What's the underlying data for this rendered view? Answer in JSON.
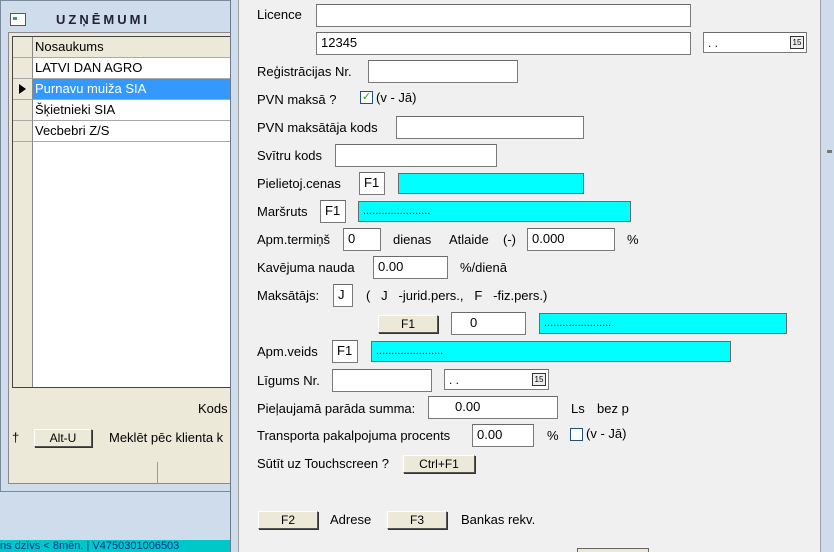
{
  "back_window": {
    "title": "UZŅĒMUMI",
    "grid": {
      "header": "Nosaukums",
      "rows": [
        "LATVI DAN AGRO",
        "Purnavu muiža SIA",
        "Šķietnieki SIA",
        "Vecbebri Z/S"
      ],
      "selected_index": 1
    },
    "kods_label": "Kods",
    "plus_label": "†",
    "altu_button": "Alt-U",
    "search_text": "Meklēt pēc klienta k"
  },
  "status_bar": "ns dzīvs < 8mēn. | V4750301006503",
  "form": {
    "licence_label": "Licence",
    "licence_value1": "",
    "licence_value2": "12345",
    "licence_date": ". .",
    "registration_label": "Reģistrācijas Nr.",
    "registration_value": "",
    "pvn_payer_label": "PVN maksā ?",
    "pvn_payer_checked": true,
    "pvn_payer_hint": "(v - Jā)",
    "pvn_code_label": "PVN maksātāja kods",
    "pvn_code_value": "",
    "barcode_label": "Svītru kods",
    "barcode_value": "",
    "price_label": "Pielietoj.cenas",
    "price_f1": "F1",
    "price_desc": "",
    "route_label": "Maršruts",
    "route_f1": "F1",
    "route_desc": "......................",
    "term_label": "Apm.termiņš",
    "term_value": "0",
    "days_label": "dienas",
    "discount_label": "Atlaide",
    "discount_sign": "(-)",
    "discount_value": "0.000",
    "percent_sign": "%",
    "penalty_label": "Kavējuma nauda",
    "penalty_value": "0.00",
    "penalty_unit": "%/dienā",
    "payer_label": "Maksātājs:",
    "payer_value": "J",
    "payer_hint": "(   J   -jurid.pers.,   F   -fiz.pers.)",
    "payer_f1": "F1",
    "payer_code": "0",
    "payer_desc": "......................",
    "payment_type_label": "Apm.veids",
    "payment_type_f1": "F1",
    "payment_type_desc": "......................",
    "contract_label": "Līgums Nr.",
    "contract_value": "",
    "contract_date": ". .",
    "debt_label": "Pieļaujamā parāda summa:",
    "debt_value": "0.00",
    "debt_currency": "Ls",
    "debt_bez": "bez p",
    "transport_label": "Transporta pakalpojuma procents",
    "transport_value": "0.00",
    "transport_percent": "%",
    "transport_checked": false,
    "transport_hint": "(v - Jā)",
    "touchscreen_label": "Sūtīt uz Touchscreen ?",
    "touchscreen_button": "Ctrl+F1",
    "f2_button": "F2",
    "address_label": "Adrese",
    "f3_button": "F3",
    "bank_label": "Bankas rekv."
  },
  "colors": {
    "highlight": "#00ffff",
    "selection": "#3399ff",
    "status_bg": "#00c8c8"
  },
  "icons": {
    "calendar": "calendar-icon",
    "row_pointer": "row-pointer-icon",
    "window": "window-icon"
  }
}
